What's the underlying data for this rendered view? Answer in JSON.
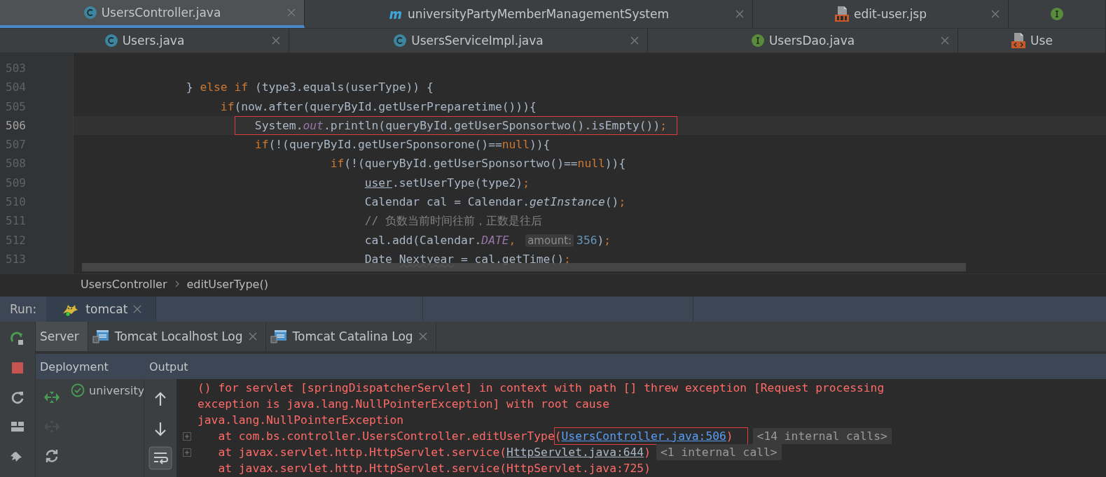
{
  "tab_rows": [
    {
      "tabs": [
        {
          "label": "UsersController.java",
          "kind": "class",
          "selected": true,
          "closable": true
        },
        {
          "label": "universityPartyMemberManagementSystem",
          "kind": "maven",
          "selected": false,
          "closable": true
        },
        {
          "label": "edit-user.jsp",
          "kind": "jsp",
          "selected": false,
          "closable": true
        },
        {
          "kind": "interface",
          "selected": false,
          "closable": false
        }
      ]
    },
    {
      "tabs": [
        {
          "label": "Users.java",
          "kind": "class",
          "selected": false,
          "closable": true
        },
        {
          "label": "UsersServiceImpl.java",
          "kind": "class",
          "selected": false,
          "closable": true
        },
        {
          "label": "UsersDao.java",
          "kind": "interface",
          "selected": false,
          "closable": true
        },
        {
          "label": "Use",
          "kind": "xml",
          "selected": false,
          "closable": false
        }
      ]
    }
  ],
  "code": {
    "lines": [
      {
        "number": "503",
        "current": false
      },
      {
        "number": "504",
        "current": false,
        "segments": [
          {
            "text": "                } ",
            "kind": "plain"
          },
          {
            "text": "else if",
            "kind": "keyword"
          },
          {
            "text": " (type3.equals(userType)) {",
            "kind": "plain"
          }
        ]
      },
      {
        "number": "505",
        "current": false,
        "segments": [
          {
            "text": "                     if",
            "kind": "keyword"
          },
          {
            "text": "(now.after(queryById.getUserPreparetime())){",
            "kind": "plain"
          }
        ]
      },
      {
        "number": "506",
        "current": true,
        "segments": [
          {
            "kind": "boxed",
            "parts": [
              {
                "text": "                          System.",
                "kind": "plain"
              },
              {
                "text": "out",
                "kind": "static"
              },
              {
                "text": ".println(queryById.getUserSponsortwo().isEmpty())",
                "kind": "plain"
              },
              {
                "text": ";",
                "kind": "keyword"
              }
            ]
          }
        ]
      },
      {
        "number": "507",
        "current": false,
        "segments": [
          {
            "text": "                          if",
            "kind": "keyword"
          },
          {
            "text": "(!(queryById.getUserSponsorone()==",
            "kind": "plain"
          },
          {
            "text": "null",
            "kind": "keyword"
          },
          {
            "text": ")){",
            "kind": "plain"
          }
        ]
      },
      {
        "number": "508",
        "current": false,
        "segments": [
          {
            "text": "                                     if",
            "kind": "keyword"
          },
          {
            "text": "(!(queryById.getUserSponsortwo()==",
            "kind": "plain"
          },
          {
            "text": "null",
            "kind": "keyword"
          },
          {
            "text": ")){",
            "kind": "plain"
          }
        ]
      },
      {
        "number": "509",
        "current": false,
        "segments": [
          {
            "text": "                                          user",
            "kind": "underlined"
          },
          {
            "text": ".setUserType(type2)",
            "kind": "plain"
          },
          {
            "text": ";",
            "kind": "keyword"
          }
        ]
      },
      {
        "number": "510",
        "current": false,
        "segments": [
          {
            "text": "                                          Calendar cal = Calendar.",
            "kind": "plain"
          },
          {
            "text": "getInstance",
            "kind": "italic"
          },
          {
            "text": "()",
            "kind": "plain"
          },
          {
            "text": ";",
            "kind": "keyword"
          }
        ]
      },
      {
        "number": "511",
        "current": false,
        "segments": [
          {
            "text": "                                          // 负数当前时间往前，正数是往后",
            "kind": "comment"
          }
        ]
      },
      {
        "number": "512",
        "current": false,
        "segments": [
          {
            "text": "                                          cal.add(Calendar.",
            "kind": "plain"
          },
          {
            "text": "DATE",
            "kind": "static"
          },
          {
            "text": ", ",
            "kind": "keyword"
          },
          {
            "text": "amount:",
            "kind": "hint"
          },
          {
            "text": "356",
            "kind": "number"
          },
          {
            "text": ")",
            "kind": "plain"
          },
          {
            "text": ";",
            "kind": "keyword"
          }
        ]
      },
      {
        "number": "513",
        "current": false,
        "segments": [
          {
            "text": "                                          Date ",
            "kind": "plain"
          },
          {
            "text": "Nextyear",
            "kind": "warning"
          },
          {
            "text": " = cal.getTime()",
            "kind": "plain"
          },
          {
            "text": ";",
            "kind": "keyword"
          }
        ]
      }
    ]
  },
  "breadcrumb": [
    "UsersController",
    "editUserType()"
  ],
  "run": {
    "label": "Run:",
    "config": "tomcat"
  },
  "main_tools": [
    {
      "kind": "rerun"
    },
    {
      "kind": "stop"
    },
    {
      "kind": "restart"
    },
    {
      "kind": "layout"
    },
    {
      "kind": "pin"
    }
  ],
  "server_tabs": [
    {
      "label": "Server",
      "kind": "plain",
      "selected": true
    },
    {
      "label": "Tomcat Localhost Log",
      "kind": "log",
      "selected": false
    },
    {
      "label": "Tomcat Catalina Log",
      "kind": "log",
      "selected": false
    }
  ],
  "panels": {
    "deployment": "Deployment",
    "output": "Output"
  },
  "deploy_tools": [
    {
      "kind": "deploy",
      "disabled": false
    },
    {
      "kind": "undeploy",
      "disabled": true
    },
    {
      "kind": "update",
      "disabled": false
    }
  ],
  "deployments": [
    {
      "name": "university",
      "deployed": true
    }
  ],
  "output_tools": [
    {
      "kind": "up",
      "on": false
    },
    {
      "kind": "down",
      "on": false
    },
    {
      "kind": "wrap",
      "on": true
    }
  ],
  "output_lines": [
    {
      "foldable": false,
      "segments": [
        {
          "text": "() for servlet [springDispatcherServlet] in context with path [] threw exception [Request processing",
          "kind": "text"
        }
      ]
    },
    {
      "foldable": false,
      "segments": [
        {
          "text": "exception is java.lang.NullPointerException] with root cause",
          "kind": "text"
        }
      ]
    },
    {
      "foldable": false,
      "segments": [
        {
          "text": "java.lang.NullPointerException",
          "kind": "text"
        }
      ]
    },
    {
      "foldable": true,
      "segments": [
        {
          "text": "   at com.bs.controller.UsersController.editUserType",
          "kind": "text"
        },
        {
          "kind": "boxed",
          "parts": [
            {
              "text": "(",
              "kind": "text"
            },
            {
              "text": "UsersController.java:506",
              "kind": "link"
            },
            {
              "text": ")",
              "kind": "text"
            }
          ]
        },
        {
          "text": "<14 internal calls>",
          "kind": "collapsed"
        }
      ]
    },
    {
      "foldable": true,
      "segments": [
        {
          "text": "   at javax.servlet.http.HttpServlet.service(",
          "kind": "text"
        },
        {
          "text": "HttpServlet.java:644",
          "kind": "file"
        },
        {
          "text": ")",
          "kind": "text"
        },
        {
          "text": "<1 internal call>",
          "kind": "collapsed"
        }
      ]
    },
    {
      "foldable": false,
      "segments": [
        {
          "text": "   at javax.servlet.http.HttpServlet.service(HttpServlet.java:725)",
          "kind": "text"
        }
      ]
    }
  ]
}
